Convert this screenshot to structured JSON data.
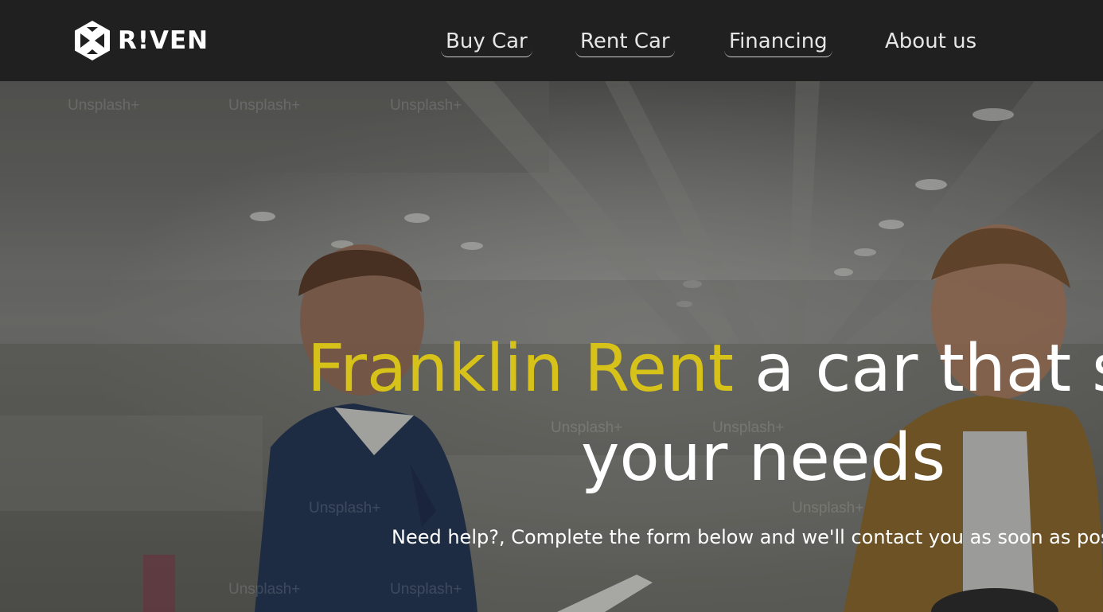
{
  "brand": {
    "logo_text": "R!VEN",
    "logo_icon": "riven-hexagon-logo-icon"
  },
  "nav": {
    "items": [
      {
        "label": "Buy Car"
      },
      {
        "label": "Rent Car"
      },
      {
        "label": "Financing"
      },
      {
        "label": "About us"
      }
    ]
  },
  "hero": {
    "title_highlight": "Franklin Rent",
    "title_rest": " a car that su",
    "title_line2": "your needs",
    "subtitle": "Need help?, Complete the form below and we'll contact you as soon as possip",
    "watermark_text": "Unsplash+"
  },
  "colors": {
    "header_bg": "#202020",
    "brand_accent": "#d7c21a",
    "text_white": "#ffffff"
  }
}
